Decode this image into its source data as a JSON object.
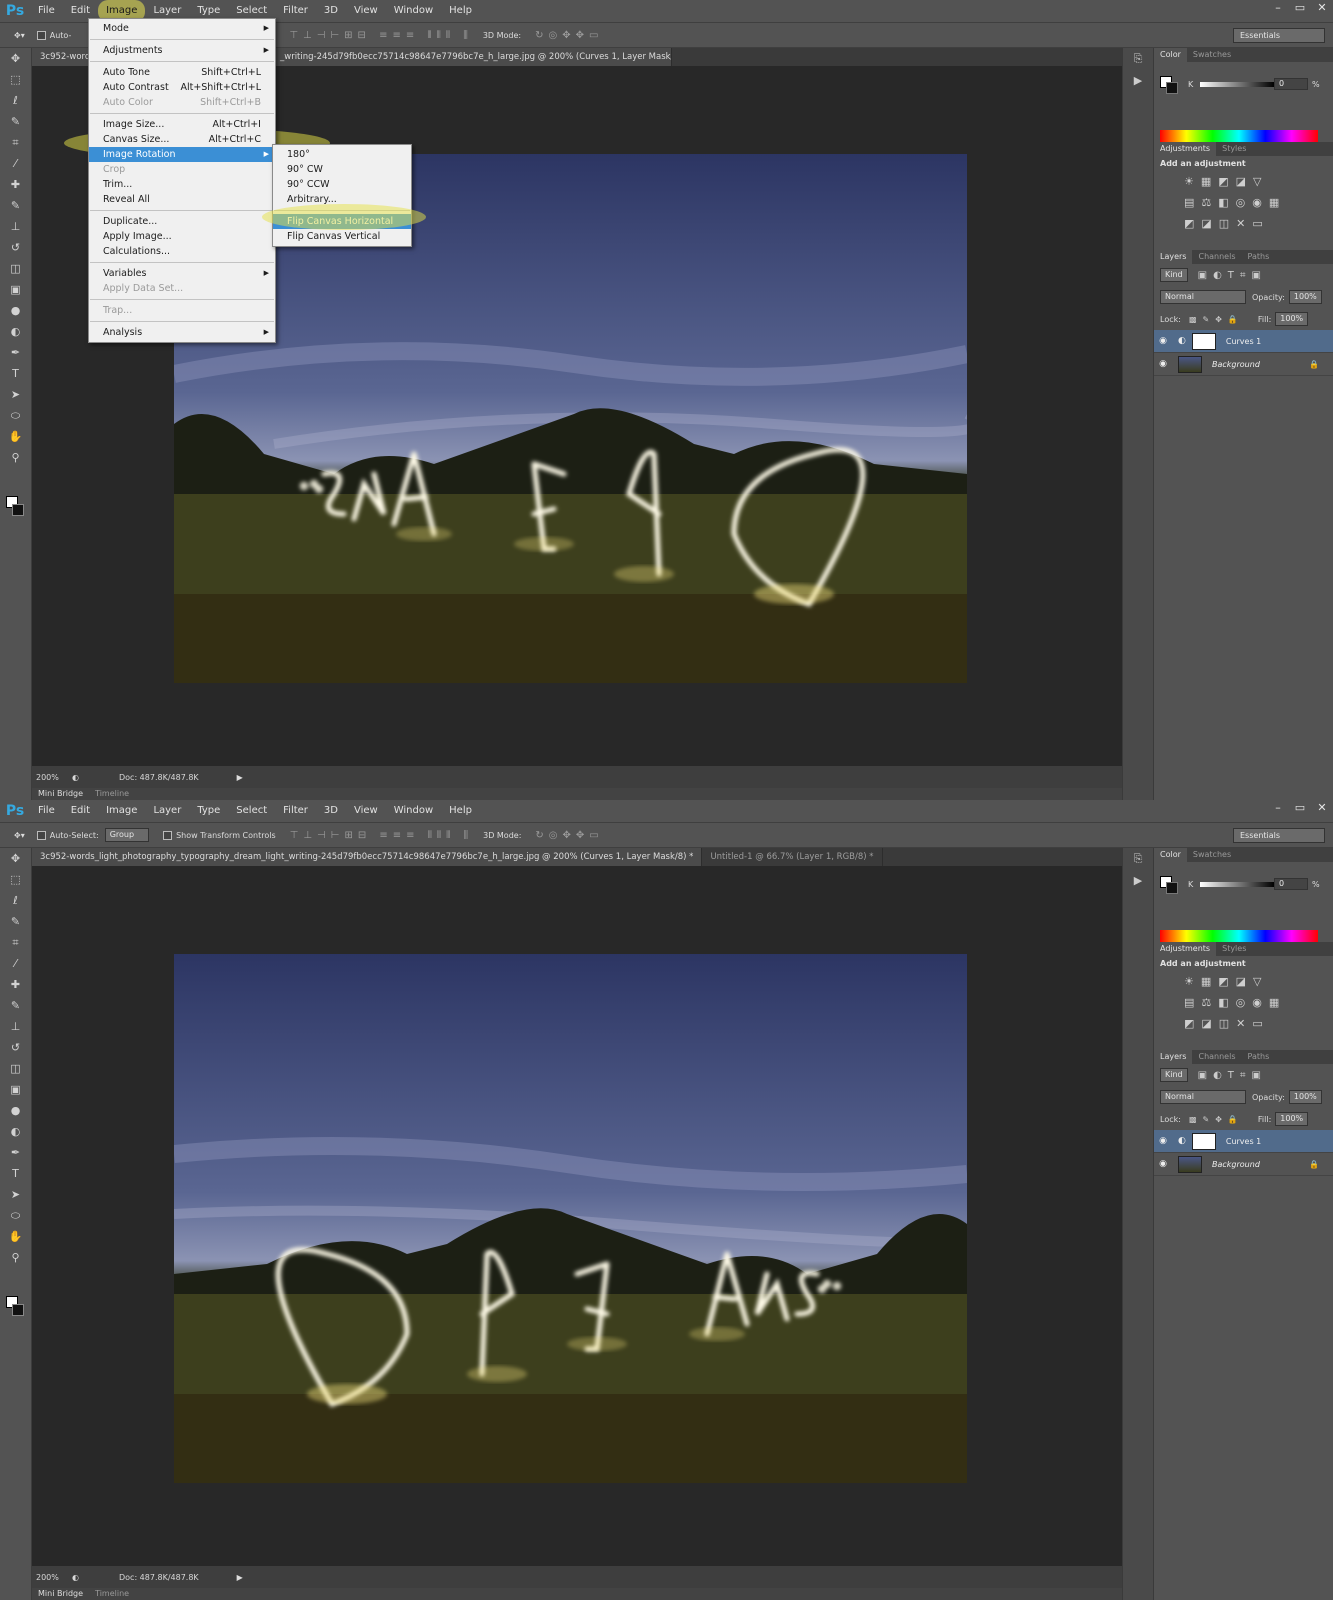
{
  "menubar": {
    "logo": "Ps",
    "items": [
      "File",
      "Edit",
      "Image",
      "Layer",
      "Type",
      "Select",
      "Filter",
      "3D",
      "View",
      "Window",
      "Help"
    ]
  },
  "window_controls": [
    "–",
    "▭",
    "✕"
  ],
  "options": {
    "auto_select": "Auto-Select:",
    "auto_select_value": "Group",
    "show_transform": "Show Transform Controls",
    "mode_3d": "3D Mode:",
    "workspace": "Essentials"
  },
  "options_top_partial": {
    "auto_select": "Auto-"
  },
  "doc_tabs_top": {
    "partial_left": "3c952-words",
    "partial_right": "_writing-245d79fb0ecc75714c98647e7796bc7e_h_large.jpg @ 200% (Curves 1, Layer Mask/8) *"
  },
  "doc_tabs_bottom": {
    "active": "3c952-words_light_photography_typography_dream_light_writing-245d79fb0ecc75714c98647e7796bc7e_h_large.jpg @ 200% (Curves 1, Layer Mask/8) *",
    "inactive": "Untitled-1 @ 66.7% (Layer 1, RGB/8) *"
  },
  "status": {
    "zoom": "200%",
    "doc": "Doc: 487.8K/487.8K"
  },
  "bottom_tabs": [
    "Mini Bridge",
    "Timeline"
  ],
  "image_menu": [
    {
      "label": "Mode",
      "sub": true
    },
    {
      "sep": true
    },
    {
      "label": "Adjustments",
      "sub": true
    },
    {
      "sep": true
    },
    {
      "label": "Auto Tone",
      "shortcut": "Shift+Ctrl+L"
    },
    {
      "label": "Auto Contrast",
      "shortcut": "Alt+Shift+Ctrl+L"
    },
    {
      "label": "Auto Color",
      "shortcut": "Shift+Ctrl+B",
      "disabled": true
    },
    {
      "sep": true
    },
    {
      "label": "Image Size...",
      "shortcut": "Alt+Ctrl+I"
    },
    {
      "label": "Canvas Size...",
      "shortcut": "Alt+Ctrl+C"
    },
    {
      "label": "Image Rotation",
      "sub": true,
      "selected": true
    },
    {
      "label": "Crop",
      "disabled": true
    },
    {
      "label": "Trim..."
    },
    {
      "label": "Reveal All"
    },
    {
      "sep": true
    },
    {
      "label": "Duplicate..."
    },
    {
      "label": "Apply Image..."
    },
    {
      "label": "Calculations..."
    },
    {
      "sep": true
    },
    {
      "label": "Variables",
      "sub": true
    },
    {
      "label": "Apply Data Set...",
      "disabled": true
    },
    {
      "sep": true
    },
    {
      "label": "Trap...",
      "disabled": true
    },
    {
      "sep": true
    },
    {
      "label": "Analysis",
      "sub": true
    }
  ],
  "rotation_menu": [
    {
      "label": "180°"
    },
    {
      "label": "90° CW"
    },
    {
      "label": "90° CCW"
    },
    {
      "label": "Arbitrary..."
    },
    {
      "sep": true
    },
    {
      "label": "Flip Canvas Horizontal",
      "selected": true
    },
    {
      "label": "Flip Canvas Vertical"
    }
  ],
  "panels": {
    "color_tabs": [
      "Color",
      "Swatches"
    ],
    "k_label": "K",
    "k_value": "0",
    "percent": "%",
    "adj_tabs": [
      "Adjustments",
      "Styles"
    ],
    "adj_title": "Add an adjustment",
    "layer_tabs": [
      "Layers",
      "Channels",
      "Paths"
    ],
    "kind": "Kind",
    "blend": "Normal",
    "opacity_label": "Opacity:",
    "opacity": "100%",
    "lock_label": "Lock:",
    "fill_label": "Fill:",
    "fill": "100%",
    "layers": [
      {
        "name": "Curves 1",
        "selected": true
      },
      {
        "name": "Background",
        "selected": false
      }
    ]
  },
  "photo_text_mirrored": "DREAMS...",
  "photo_text": "DREAMS..."
}
